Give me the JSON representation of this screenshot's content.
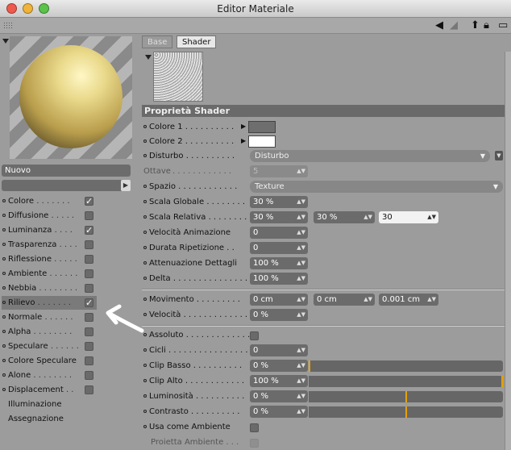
{
  "window": {
    "title": "Editor Materiale"
  },
  "colors": {
    "close": "#ee5a4e",
    "minimize": "#f0b43a",
    "zoom": "#5bc24a",
    "accent": "#e8a200",
    "color2": "#ffffff",
    "color1": "#6e6e6e"
  },
  "toolbar": {
    "icons": [
      "grip-icon",
      "back-arrow-icon",
      "forward-arrow-icon",
      "lock-icon",
      "new-window-icon"
    ]
  },
  "material": {
    "name": "Nuovo"
  },
  "channels": [
    {
      "label": "Colore",
      "dots": ". . . . . . .",
      "checked": true
    },
    {
      "label": "Diffusione",
      "dots": ". . . . .",
      "checked": false
    },
    {
      "label": "Luminanza",
      "dots": ". . . .",
      "checked": true
    },
    {
      "label": "Trasparenza",
      "dots": ". . . .",
      "checked": false
    },
    {
      "label": "Riflessione",
      "dots": ". . . . .",
      "checked": false
    },
    {
      "label": "Ambiente",
      "dots": ". . . . . .",
      "checked": false
    },
    {
      "label": "Nebbia",
      "dots": ". . . . . . . .",
      "checked": false
    },
    {
      "label": "Rilievo",
      "dots": ". . . . . . .",
      "checked": true
    },
    {
      "label": "Normale",
      "dots": ". . . . . .",
      "checked": false
    },
    {
      "label": "Alpha",
      "dots": ". . . . . . . .",
      "checked": false
    },
    {
      "label": "Speculare",
      "dots": ". . . . . .",
      "checked": false
    },
    {
      "label": "Colore Speculare",
      "dots": "",
      "checked": false
    },
    {
      "label": "Alone",
      "dots": ". . . . . . . .",
      "checked": false
    },
    {
      "label": "Displacement",
      "dots": ". .",
      "checked": false
    }
  ],
  "extra_items": [
    "Illuminazione",
    "Assegnazione"
  ],
  "tabs": [
    {
      "label": "Base"
    },
    {
      "label": "Shader"
    }
  ],
  "section_title": "Proprietà Shader",
  "params": {
    "colore1": {
      "label": "Colore 1",
      "dots": ". . . . . . . . . ."
    },
    "colore2": {
      "label": "Colore 2",
      "dots": ". . . . . . . . . ."
    },
    "disturbo": {
      "label": "Disturbo",
      "dots": ". . . . . . . . . .",
      "value": "Disturbo"
    },
    "ottave": {
      "label": "Ottave",
      "dots": ". . . . . . . . . . . .",
      "value": "5"
    },
    "spazio": {
      "label": "Spazio",
      "dots": ". . . . . . . . . . . .",
      "value": "Texture"
    },
    "scala_globale": {
      "label": "Scala Globale",
      "dots": ". . . . . . . .",
      "value": "30 %"
    },
    "scala_relativa": {
      "label": "Scala Relativa",
      "dots": ". . . . . . . .",
      "values": [
        "30 %",
        "30 %",
        "30"
      ]
    },
    "velocita_animazione": {
      "label": "Velocità Animazione",
      "dots": "",
      "value": "0"
    },
    "durata_ripetizione": {
      "label": "Durata Ripetizione",
      "dots": ". .",
      "value": "0"
    },
    "attenuazione_dettagli": {
      "label": "Attenuazione Dettagli",
      "dots": "",
      "value": "100 %"
    },
    "delta": {
      "label": "Delta",
      "dots": ". . . . . . . . . . . . . . .",
      "value": "100 %"
    },
    "movimento": {
      "label": "Movimento",
      "dots": ". . . . . . . . .",
      "values": [
        "0 cm",
        "0 cm",
        "0.001 cm"
      ]
    },
    "velocita": {
      "label": "Velocità",
      "dots": ". . . . . . . . . . . . .",
      "value": "0 %"
    },
    "assoluto": {
      "label": "Assoluto",
      "dots": ". . . . . . . . . . . . ."
    },
    "cicli": {
      "label": "Cicli",
      "dots": ". . . . . . . . . . . . . . . .",
      "value": "0"
    },
    "clip_basso": {
      "label": "Clip Basso",
      "dots": ". . . . . . . . . .",
      "value": "0 %",
      "level": 0
    },
    "clip_alto": {
      "label": "Clip Alto",
      "dots": ". . . . . . . . . . . .",
      "value": "100 %",
      "level": 100
    },
    "luminosita": {
      "label": "Luminosità",
      "dots": ". . . . . . . . . .",
      "value": "0 %",
      "level": 50
    },
    "contrasto": {
      "label": "Contrasto",
      "dots": ". . . . . . . . . .",
      "value": "0 %",
      "level": 50
    },
    "usa_come_ambiente": {
      "label": "Usa come Ambiente",
      "dots": ""
    },
    "proietta_ambiente": {
      "label": "Proietta Ambiente",
      "dots": ". . ."
    }
  }
}
